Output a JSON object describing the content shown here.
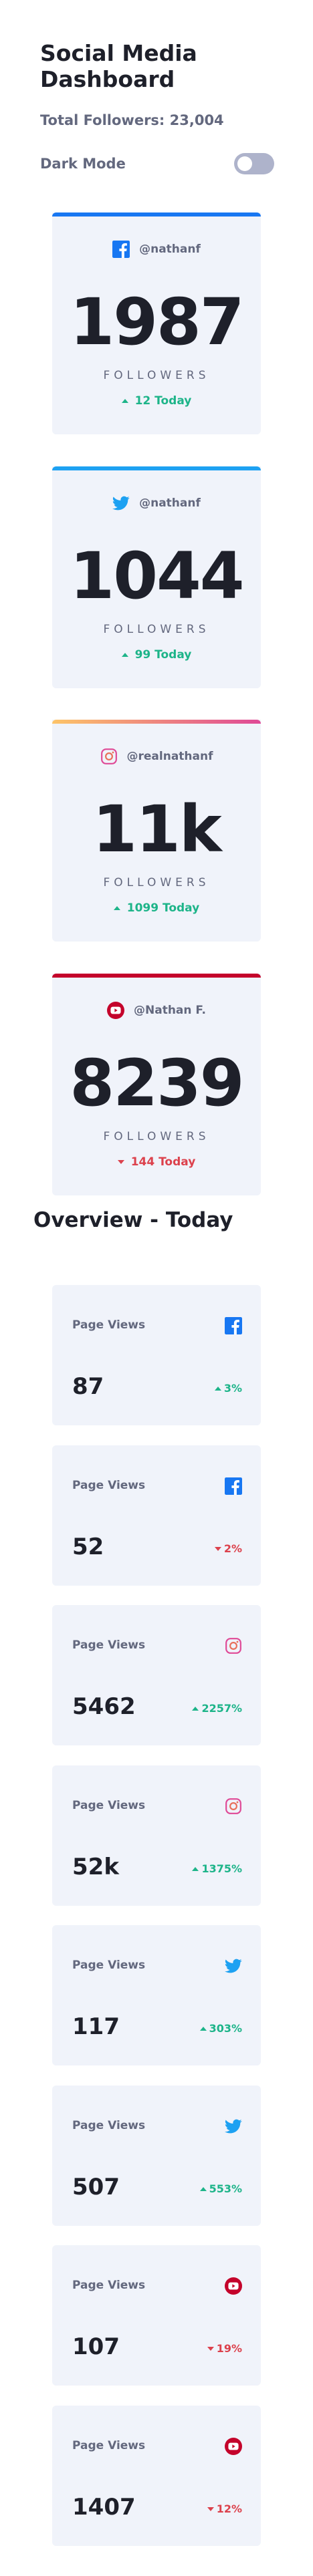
{
  "header": {
    "title": "Social Media Dashboard",
    "total_followers": "Total Followers: 23,004"
  },
  "dark_mode": {
    "label": "Dark Mode",
    "enabled": false
  },
  "colors": {
    "facebook": "#1877f2",
    "twitter": "#1da1f2",
    "instagram_start": "#fdc468",
    "instagram_end": "#df4996",
    "youtube": "#c4032b",
    "up": "#1db489",
    "down": "#dc414c"
  },
  "follower_cards": [
    {
      "network": "facebook",
      "icon": "facebook-icon",
      "handle": "@nathanf",
      "count": "1987",
      "label": "FOLLOWERS",
      "today": "12 Today",
      "trend": "up"
    },
    {
      "network": "twitter",
      "icon": "twitter-icon",
      "handle": "@nathanf",
      "count": "1044",
      "label": "FOLLOWERS",
      "today": "99 Today",
      "trend": "up"
    },
    {
      "network": "instagram",
      "icon": "instagram-icon",
      "handle": "@realnathanf",
      "count": "11k",
      "label": "FOLLOWERS",
      "today": "1099 Today",
      "trend": "up"
    },
    {
      "network": "youtube",
      "icon": "youtube-icon",
      "handle": "@Nathan F.",
      "count": "8239",
      "label": "FOLLOWERS",
      "today": "144 Today",
      "trend": "down"
    }
  ],
  "overview": {
    "title": "Overview - Today",
    "cards": [
      {
        "metric": "Page Views",
        "icon": "facebook-icon",
        "value": "87",
        "change": "3%",
        "trend": "up"
      },
      {
        "metric": "Page Views",
        "icon": "facebook-icon",
        "value": "52",
        "change": "2%",
        "trend": "down"
      },
      {
        "metric": "Page Views",
        "icon": "instagram-icon",
        "value": "5462",
        "change": "2257%",
        "trend": "up"
      },
      {
        "metric": "Page Views",
        "icon": "instagram-icon",
        "value": "52k",
        "change": "1375%",
        "trend": "up"
      },
      {
        "metric": "Page Views",
        "icon": "twitter-icon",
        "value": "117",
        "change": "303%",
        "trend": "up"
      },
      {
        "metric": "Page Views",
        "icon": "twitter-icon",
        "value": "507",
        "change": "553%",
        "trend": "up"
      },
      {
        "metric": "Page Views",
        "icon": "youtube-icon",
        "value": "107",
        "change": "19%",
        "trend": "down"
      },
      {
        "metric": "Page Views",
        "icon": "youtube-icon",
        "value": "1407",
        "change": "12%",
        "trend": "down"
      }
    ]
  }
}
